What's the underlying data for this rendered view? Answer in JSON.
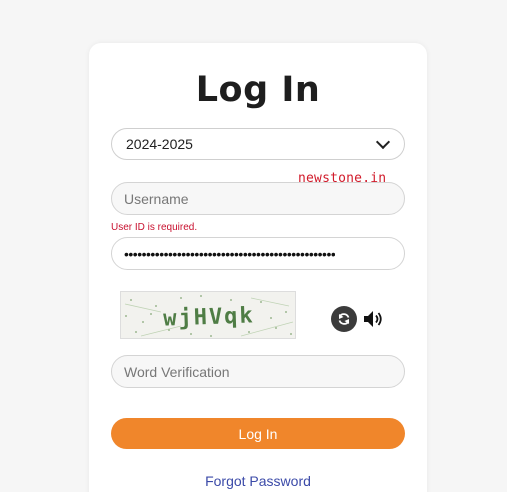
{
  "form": {
    "title": "Log In",
    "session_select": {
      "selected": "2024-2025"
    },
    "watermark": "newstone.in",
    "username": {
      "placeholder": "Username",
      "value": ""
    },
    "username_error": "User ID is required.",
    "password": {
      "value_masked": "••••••••••••••••••••••••••••••••••••••••••••••••"
    },
    "captcha": {
      "text": "wjHVqk",
      "refresh_icon": "refresh-icon",
      "audio_icon": "speaker-icon"
    },
    "word_verification": {
      "placeholder": "Word Verification"
    },
    "login_button": "Log In",
    "forgot_password": "Forgot Password"
  },
  "colors": {
    "button": "#f0862b",
    "error": "#c8102e",
    "link": "#3b4aa8",
    "watermark": "#d11a2a"
  }
}
